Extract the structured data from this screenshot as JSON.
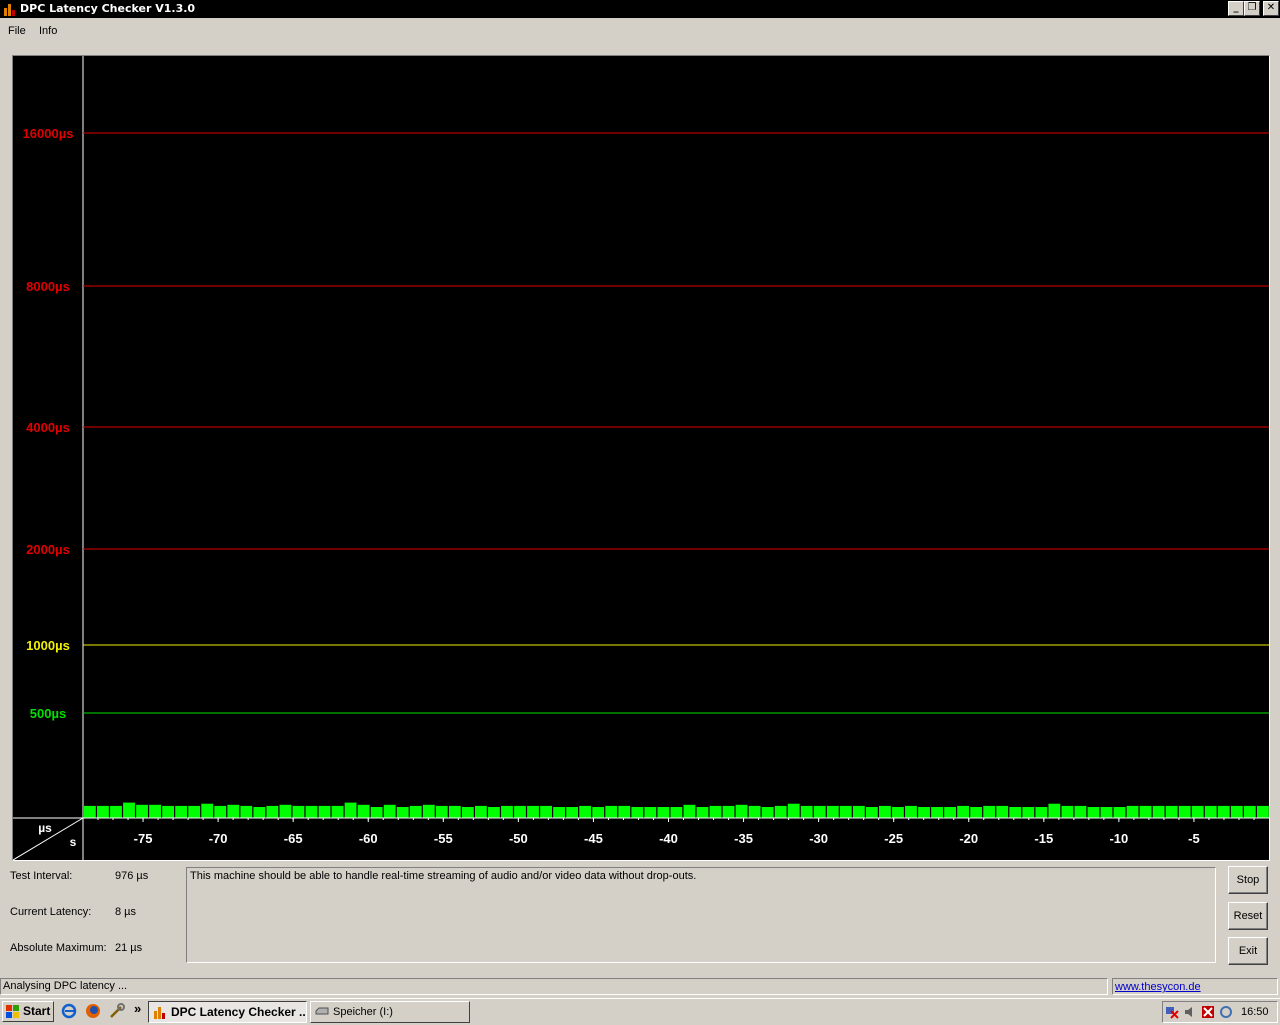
{
  "window": {
    "title": "DPC Latency Checker V1.3.0"
  },
  "menu": {
    "items": [
      "File",
      "Info"
    ]
  },
  "chart_data": {
    "type": "bar",
    "y_levels": [
      {
        "label": "16000µs",
        "value": 16000,
        "color": "#e00000"
      },
      {
        "label": "8000µs",
        "value": 8000,
        "color": "#e00000"
      },
      {
        "label": "4000µs",
        "value": 4000,
        "color": "#e00000"
      },
      {
        "label": "2000µs",
        "value": 2000,
        "color": "#e00000"
      },
      {
        "label": "1000µs",
        "value": 1000,
        "color": "#f0f000"
      },
      {
        "label": "500µs",
        "value": 500,
        "color": "#00e000"
      }
    ],
    "y_unit": "µs",
    "x_unit": "s",
    "x_ticks": [
      -75,
      -70,
      -65,
      -60,
      -55,
      -50,
      -45,
      -40,
      -35,
      -30,
      -25,
      -20,
      -15,
      -10,
      -5
    ],
    "x_range": [
      -79,
      0
    ],
    "bar_color": "#00ff00",
    "values": [
      11,
      11,
      11,
      14,
      12,
      12,
      11,
      11,
      11,
      13,
      11,
      12,
      11,
      10,
      11,
      12,
      11,
      11,
      11,
      11,
      14,
      12,
      10,
      12,
      10,
      11,
      12,
      11,
      11,
      10,
      11,
      10,
      11,
      11,
      11,
      11,
      10,
      10,
      11,
      10,
      11,
      11,
      10,
      10,
      10,
      10,
      12,
      10,
      11,
      11,
      12,
      11,
      10,
      11,
      13,
      11,
      11,
      11,
      11,
      11,
      10,
      11,
      10,
      11,
      10,
      10,
      10,
      11,
      10,
      11,
      11,
      10,
      10,
      10,
      13,
      11,
      11,
      10,
      10,
      10,
      11,
      11,
      11,
      11,
      11,
      11,
      11,
      11,
      11,
      11,
      11
    ]
  },
  "info": {
    "test_interval_label": "Test Interval:",
    "test_interval_value": "976 µs",
    "current_latency_label": "Current Latency:",
    "current_latency_value": "8 µs",
    "absolute_maximum_label": "Absolute Maximum:",
    "absolute_maximum_value": "21 µs"
  },
  "message": "This machine should be able to handle real-time streaming of audio and/or video data without drop-outs.",
  "buttons": {
    "stop": "Stop",
    "reset": "Reset",
    "exit": "Exit"
  },
  "status": {
    "text": "Analysing DPC latency ...",
    "link": "www.thesycon.de"
  },
  "taskbar": {
    "start": "Start",
    "overflow": "»",
    "tasks": [
      "DPC Latency Checker ...",
      "Speicher (I:)"
    ],
    "clock": "16:50"
  }
}
